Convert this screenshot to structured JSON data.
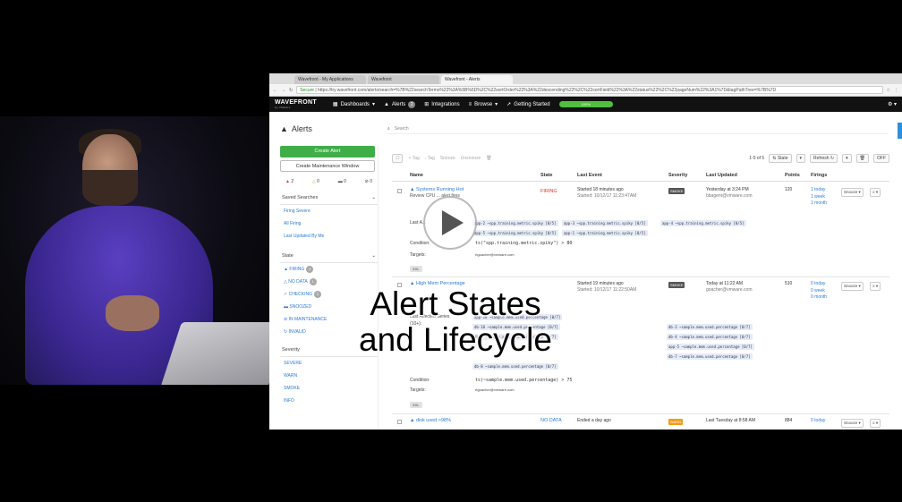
{
  "browser": {
    "tabs": [
      "Wavefront - My Applications",
      "Wavefront",
      "Wavefront - Alerts"
    ],
    "url_secure": "Secure",
    "url": "https://try.wavefront.com/alerts/search=%7B%22searchTerms%22%3A%5B%5D%2C%22sortOrder%22%3A%22descending%22%2C%22sortField%22%3A%22status%22%2C%22pageNum%22%3A1%7D&tagPathTree=%7B%7D"
  },
  "appbar": {
    "logo": "WAVEFRONT",
    "logo_sub": "by VMware",
    "dashboards": "Dashboards",
    "alerts": "Alerts",
    "alerts_count": "2",
    "integrations": "Integrations",
    "browse": "Browse",
    "getting_started": "Getting Started",
    "progress_label": "100%",
    "progress": 1.0
  },
  "page": {
    "title": "Alerts",
    "search_placeholder": "Search"
  },
  "sidebar": {
    "create": "Create Alert",
    "maintenance": "Create Maintenance Window",
    "counts": [
      "2",
      "0",
      "0",
      "0"
    ],
    "saved_searches_title": "Saved Searches",
    "saved_searches": [
      "Firing Severe",
      "All Firing",
      "Last Updated By Me"
    ],
    "state_title": "State",
    "states": [
      {
        "label": "FIRING",
        "count": "2"
      },
      {
        "label": "NO DATA",
        "count": "1"
      },
      {
        "label": "CHECKING",
        "count": "2"
      },
      {
        "label": "SNOOZED",
        "count": ""
      },
      {
        "label": "IN MAINTENANCE",
        "count": ""
      },
      {
        "label": "INVALID",
        "count": ""
      }
    ],
    "severity_title": "Severity",
    "severities": [
      "SEVERE",
      "WARN",
      "SMOKE",
      "INFO"
    ]
  },
  "toolbar": {
    "tag": "+ Tag",
    "untag": "- Tag",
    "snooze": "Snooze",
    "unsnooze": "Unsnooze",
    "range": "1-5 of 5",
    "sort": "State",
    "refresh": "Refresh",
    "off": "OFF"
  },
  "columns": [
    "Name",
    "State",
    "Last Event",
    "Severity",
    "Last Updated",
    "Points",
    "Firings"
  ],
  "rows": [
    {
      "name": "Systems Running Hot",
      "desc": "Review CPU ... alert fires",
      "state": "FIRING",
      "event": "Started 18 minutes ago",
      "event2": "Started: 10/12/17 11:23:47AM",
      "severity": "SMOKE",
      "updated": "Yesterday at 3:24 PM",
      "updated2": "bbagent@vmware.com",
      "points": "120",
      "firings": [
        "1 today",
        "1 week",
        "1 month"
      ],
      "snooze": "Snooze",
      "detail_label": "Last A...",
      "chips": [
        "app-2 ~spp.training.metric.spiky [0/5]",
        "app-3 ~spp.training.metric.spiky [0/5]",
        "app-4 ~spp.training.metric.spiky [0/5]",
        "app-5 ~spp.training.metric.spiky [0/5]",
        "app-1 ~spp.training.metric.spiky [0/5]"
      ],
      "condition_label": "Condition:",
      "condition": "ts(\"spp.training.metric.spiky\") > 80",
      "targets_label": "Targets:",
      "targets": "rtgoacher@vmware.com",
      "tag": "XXL"
    },
    {
      "name": "High Mem Percentage",
      "state": "",
      "event": "Started 19 minutes ago",
      "event2": "Started: 10/12/17 11:22:50AM",
      "severity": "SMOKE",
      "updated": "Today at 11:22 AM",
      "updated2": "goacher@vmware.com",
      "points": "510",
      "firings": [
        "0 today",
        "0 week",
        "0 month"
      ],
      "snooze": "Snooze",
      "detail_label": "Last Affected Series",
      "detail_label2": "(10+):",
      "chips": [
        "app-10 ~sample.mem.used.percentage [0/7]",
        "db-10 ~sample.mem.used.percentage [0/7]",
        "db-3 ~sample.mem.used.percentage [0/7]",
        "db-6 ~sample.mem.used.percentage [0/7]",
        "db-4 ~sample.mem.used.percentage [0/7]",
        "app-5 ~sample.mem.used.percentage [0/7]",
        "db-7 ~sample.mem.used.percentage [0/7]",
        "db-8 ~sample.mem.used.percentage [0/7]"
      ],
      "condition_label": "Condition:",
      "condition": "ts(~sample.mem.used.percentage) > 75",
      "targets_label": "Targets:",
      "targets": "rtgoacher@vmware.com",
      "tag": "XXL"
    },
    {
      "name": "disk used >98%",
      "state": "NO DATA",
      "event": "Ended a day ago",
      "severity": "WARN",
      "updated": "Last Tuesday at 8:58 AM",
      "points": "884",
      "firings": [
        "0 today"
      ],
      "snooze": "Snooze"
    }
  ],
  "overlay": {
    "title_line1": "Alert States",
    "title_line2": "and Lifecycle"
  },
  "colors": {
    "accent": "#2d7ad6",
    "create": "#3fae49",
    "firing": "#d9342b",
    "nodata": "#2d7ad6",
    "warn": "#f39c12",
    "smoke": "#555555"
  }
}
